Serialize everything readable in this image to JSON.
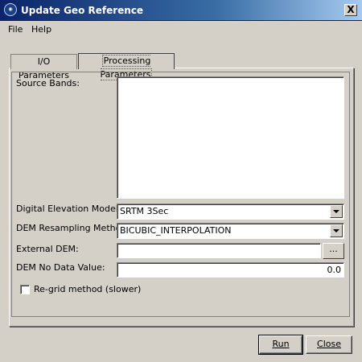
{
  "window": {
    "title": "Update Geo Reference",
    "icon": "globe-app-icon",
    "close_label": "X"
  },
  "menu": {
    "items": [
      "File",
      "Help"
    ]
  },
  "tabs": [
    {
      "label": "I/O Parameters",
      "active": false
    },
    {
      "label": "Processing Parameters",
      "active": true
    }
  ],
  "form": {
    "source_bands_label": "Source Bands:",
    "dem_label": "Digital Elevation Model:",
    "dem_value": "SRTM 3Sec",
    "resampling_label": "DEM Resampling Method:",
    "resampling_value": "BICUBIC_INTERPOLATION",
    "external_dem_label": "External DEM:",
    "external_dem_value": "",
    "browse_label": "...",
    "nodata_label": "DEM No Data Value:",
    "nodata_value": "0.0",
    "regrid_label": "Re-grid method (slower)",
    "regrid_checked": false
  },
  "buttons": {
    "run": "Run",
    "close": "Close"
  }
}
